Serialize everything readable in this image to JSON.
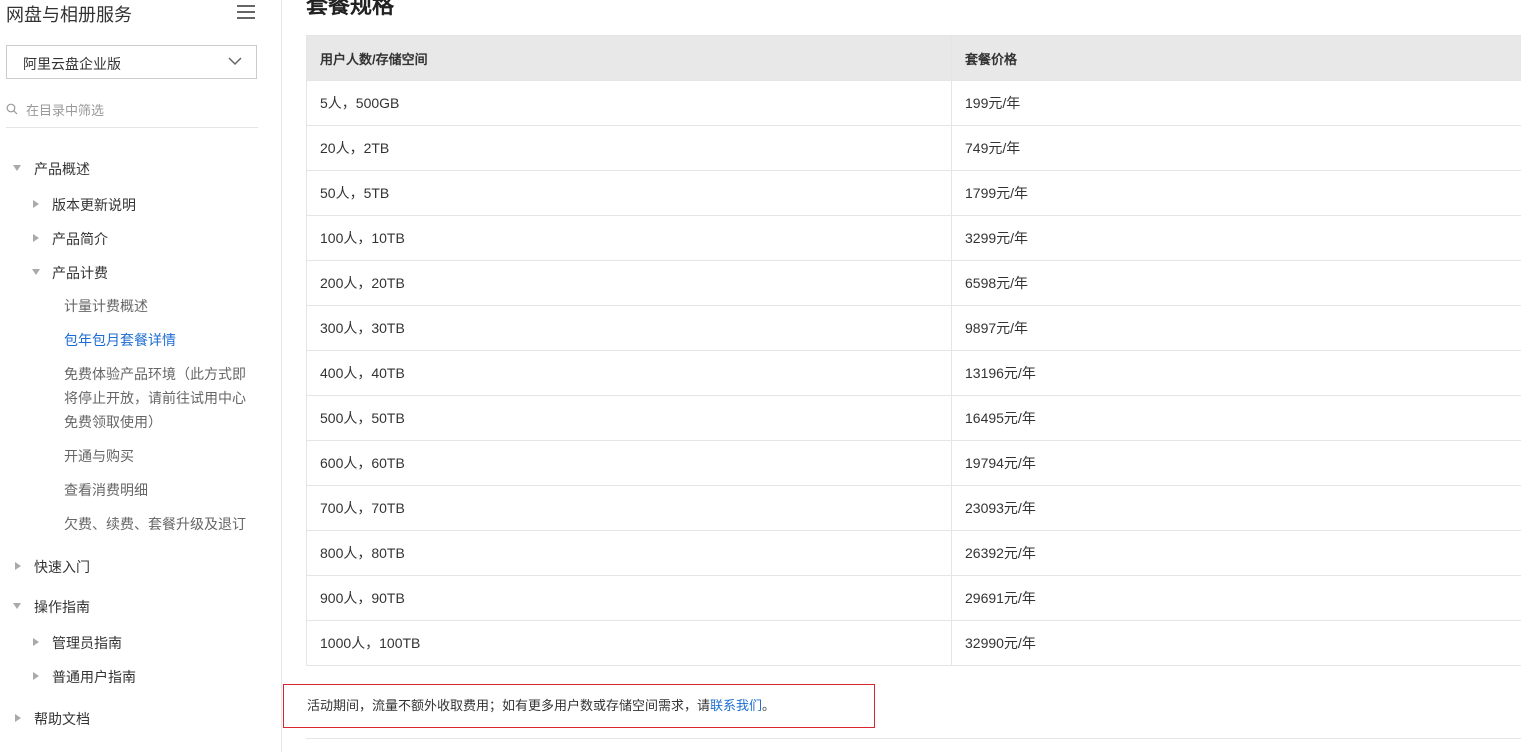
{
  "sidebar": {
    "title": "网盘与相册服务",
    "product_select": "阿里云盘企业版",
    "filter_placeholder": "在目录中筛选",
    "nav": {
      "overview": "产品概述",
      "release_notes": "版本更新说明",
      "intro": "产品简介",
      "billing": "产品计费",
      "billing_overview": "计量计费概述",
      "subscription_details": "包年包月套餐详情",
      "free_trial": "免费体验产品环境（此方式即将停止开放，请前往试用中心免费领取使用）",
      "activate": "开通与购买",
      "consumption": "查看消费明细",
      "arrears": "欠费、续费、套餐升级及退订",
      "quick_start": "快速入门",
      "guide": "操作指南",
      "admin_guide": "管理员指南",
      "user_guide": "普通用户指南",
      "help_docs": "帮助文档"
    }
  },
  "main": {
    "title": "套餐规格",
    "table": {
      "headers": [
        "用户人数/存储空间",
        "套餐价格"
      ],
      "rows": [
        [
          "5人，500GB",
          "199元/年"
        ],
        [
          "20人，2TB",
          "749元/年"
        ],
        [
          "50人，5TB",
          "1799元/年"
        ],
        [
          "100人，10TB",
          "3299元/年"
        ],
        [
          "200人，20TB",
          "6598元/年"
        ],
        [
          "300人，30TB",
          "9897元/年"
        ],
        [
          "400人，40TB",
          "13196元/年"
        ],
        [
          "500人，50TB",
          "16495元/年"
        ],
        [
          "600人，60TB",
          "19794元/年"
        ],
        [
          "700人，70TB",
          "23093元/年"
        ],
        [
          "800人，80TB",
          "26392元/年"
        ],
        [
          "900人，90TB",
          "29691元/年"
        ],
        [
          "1000人，100TB",
          "32990元/年"
        ]
      ]
    },
    "note": {
      "text": "活动期间，流量不额外收取费用；如有更多用户数或存储空间需求，请",
      "link": "联系我们",
      "suffix": "。"
    }
  },
  "colors": {
    "active_link": "#1c6ed0",
    "note_border": "#d9262c",
    "header_bg": "#e8e8e8"
  }
}
